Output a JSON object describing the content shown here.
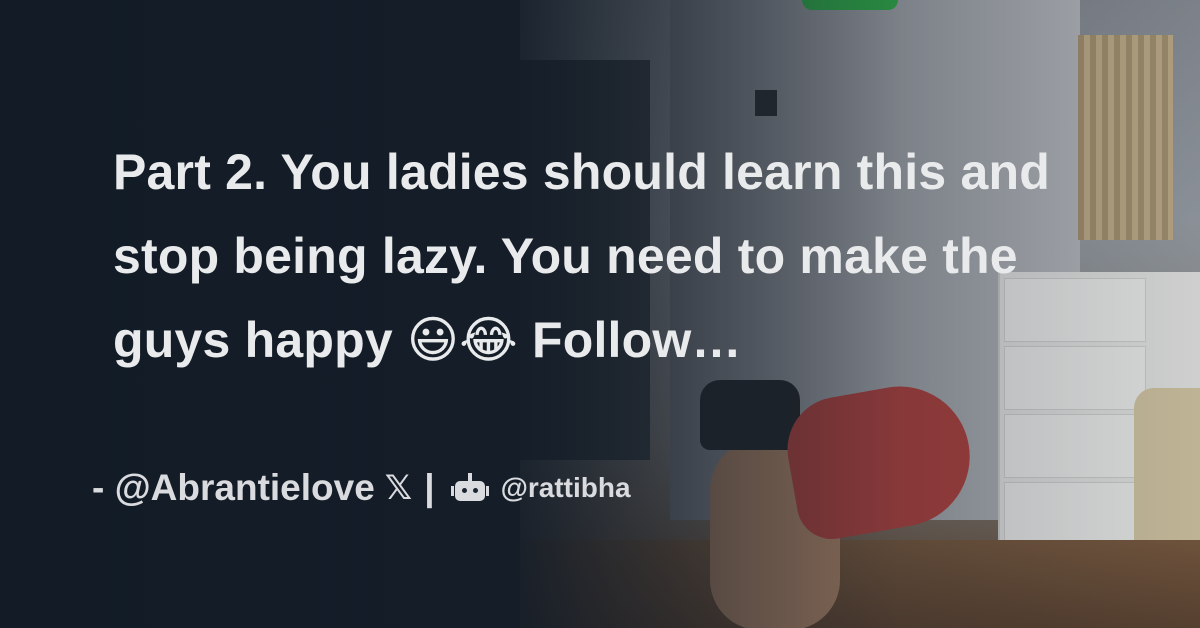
{
  "card": {
    "title": "Part 2. You ladies should learn this and stop being lazy. You need to make the guys happy 😃😂 Follow…",
    "author_line": "- @Abrantielove",
    "x_icon": "𝕏",
    "separator": "|",
    "bot_icon": "robot-icon",
    "site_handle": "@rattibha"
  },
  "colors": {
    "background": "#151f2b",
    "text": "#e9eaec"
  }
}
